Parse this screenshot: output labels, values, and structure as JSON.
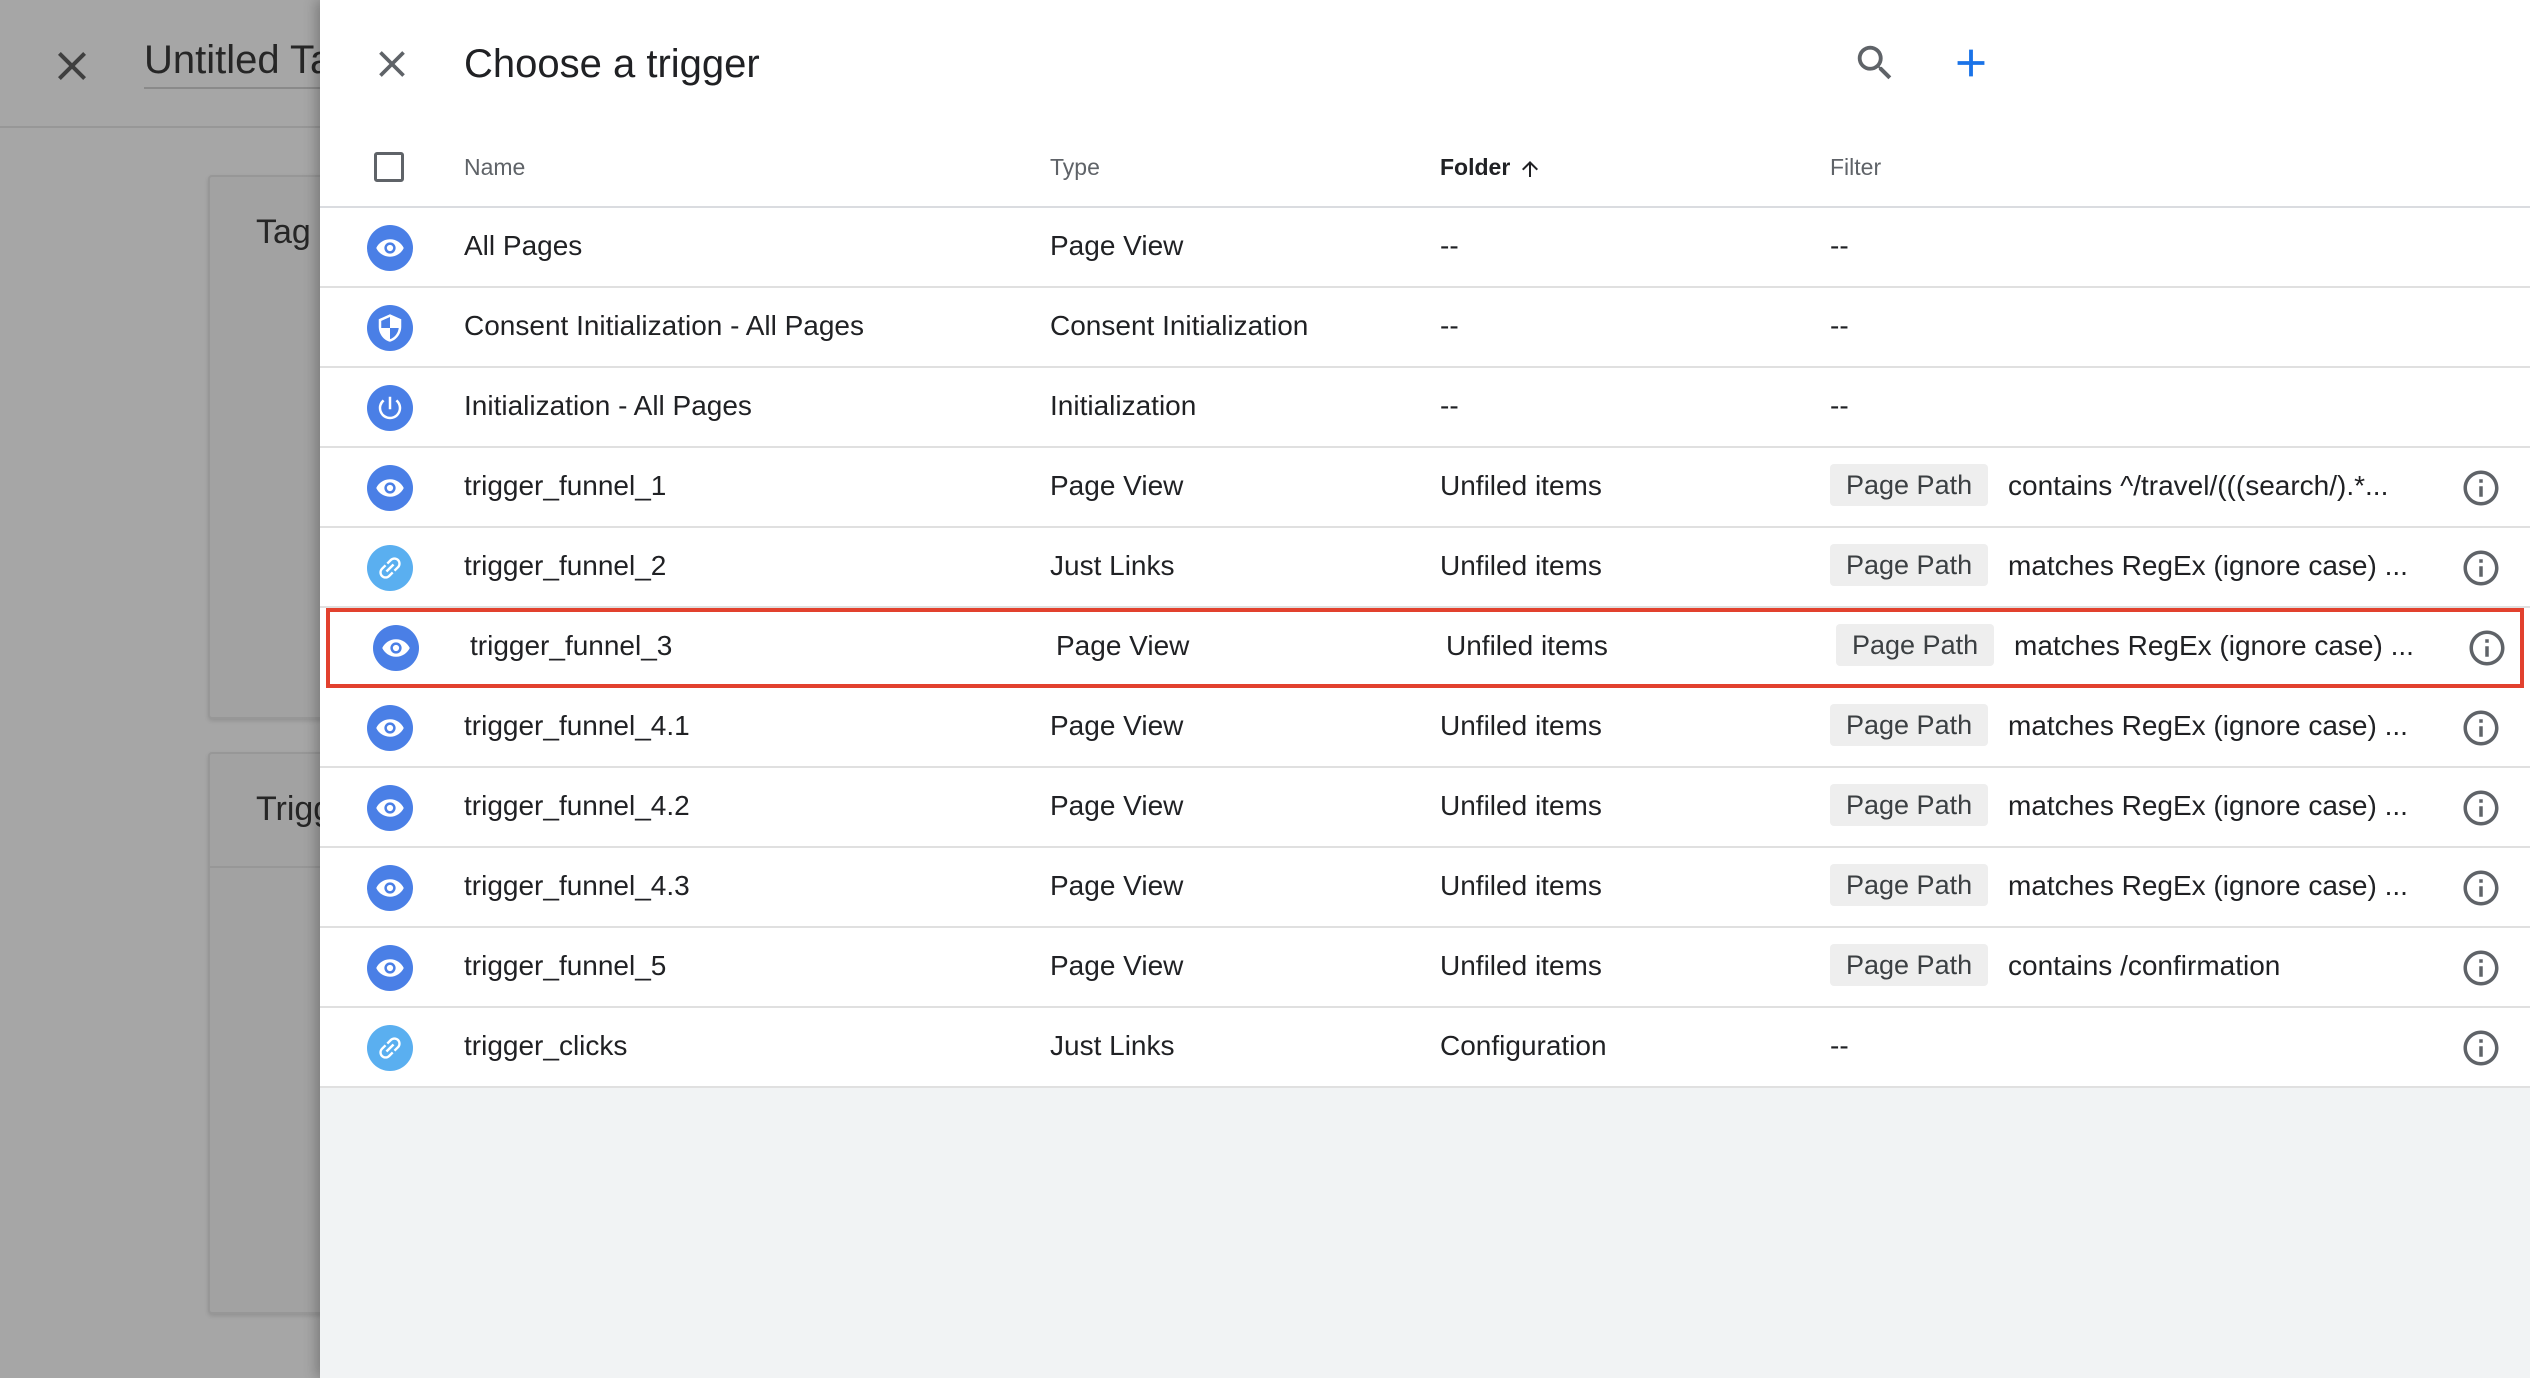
{
  "background": {
    "tag_title": "Untitled Ta",
    "card1_title": "Tag C",
    "card2_title": "Trigg"
  },
  "drawer": {
    "title": "Choose a trigger",
    "columns": {
      "name": "Name",
      "type": "Type",
      "folder": "Folder",
      "filter": "Filter"
    },
    "sort_column": "Folder",
    "rows": [
      {
        "icon": "eye-icon",
        "name": "All Pages",
        "type": "Page View",
        "folder": "--",
        "filter": "--"
      },
      {
        "icon": "shield-icon",
        "name": "Consent Initialization - All Pages",
        "type": "Consent Initialization",
        "folder": "--",
        "filter": "--"
      },
      {
        "icon": "power-icon",
        "name": "Initialization - All Pages",
        "type": "Initialization",
        "folder": "--",
        "filter": "--"
      },
      {
        "icon": "eye-icon",
        "name": "trigger_funnel_1",
        "type": "Page View",
        "folder": "Unfiled items",
        "filter_var": "Page Path",
        "filter_cond": "contains ^/travel/(((search/).*..."
      },
      {
        "icon": "link-icon",
        "name": "trigger_funnel_2",
        "type": "Just Links",
        "folder": "Unfiled items",
        "filter_var": "Page Path",
        "filter_cond": "matches RegEx (ignore case) ..."
      },
      {
        "icon": "eye-icon",
        "name": "trigger_funnel_3",
        "type": "Page View",
        "folder": "Unfiled items",
        "filter_var": "Page Path",
        "filter_cond": "matches RegEx (ignore case) ...",
        "selected": true
      },
      {
        "icon": "eye-icon",
        "name": "trigger_funnel_4.1",
        "type": "Page View",
        "folder": "Unfiled items",
        "filter_var": "Page Path",
        "filter_cond": "matches RegEx (ignore case) ..."
      },
      {
        "icon": "eye-icon",
        "name": "trigger_funnel_4.2",
        "type": "Page View",
        "folder": "Unfiled items",
        "filter_var": "Page Path",
        "filter_cond": "matches RegEx (ignore case) ..."
      },
      {
        "icon": "eye-icon",
        "name": "trigger_funnel_4.3",
        "type": "Page View",
        "folder": "Unfiled items",
        "filter_var": "Page Path",
        "filter_cond": "matches RegEx (ignore case) ..."
      },
      {
        "icon": "eye-icon",
        "name": "trigger_funnel_5",
        "type": "Page View",
        "folder": "Unfiled items",
        "filter_var": "Page Path",
        "filter_cond": "contains /confirmation"
      },
      {
        "icon": "link-icon",
        "name": "trigger_clicks",
        "type": "Just Links",
        "folder": "Configuration",
        "filter": "--"
      }
    ]
  },
  "colors": {
    "accent": "#1a73e8",
    "icon_blue": "#4a7fe6",
    "icon_light_blue": "#5aaff0",
    "selection_outline": "#e2412e"
  }
}
